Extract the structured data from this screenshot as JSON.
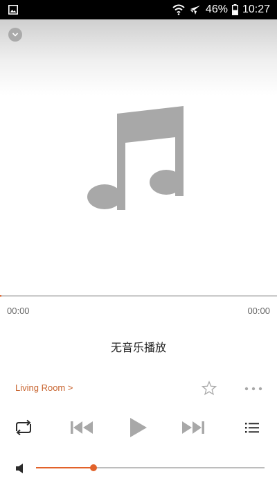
{
  "status_bar": {
    "battery": "46%",
    "time": "10:27",
    "icons": [
      "gallery-icon",
      "wifi-icon",
      "airplane-mode-icon",
      "battery-icon"
    ]
  },
  "player": {
    "collapse_icon": "chevron-down-icon",
    "artwork_icon": "music-note-icon",
    "elapsed": "00:00",
    "duration": "00:00",
    "progress_fraction": 0,
    "title": "无音乐播放",
    "room": "Living Room >",
    "volume_fraction": 0.25
  },
  "controls": {
    "icons": [
      "repeat-icon",
      "previous-icon",
      "play-icon",
      "next-icon",
      "queue-list-icon",
      "star-icon",
      "more-icon",
      "volume-icon"
    ]
  },
  "colors": {
    "accent": "#e2622a",
    "room_text": "#c8642f",
    "icon_gray": "#a8a8a8",
    "icon_dark": "#2b2b2b"
  }
}
